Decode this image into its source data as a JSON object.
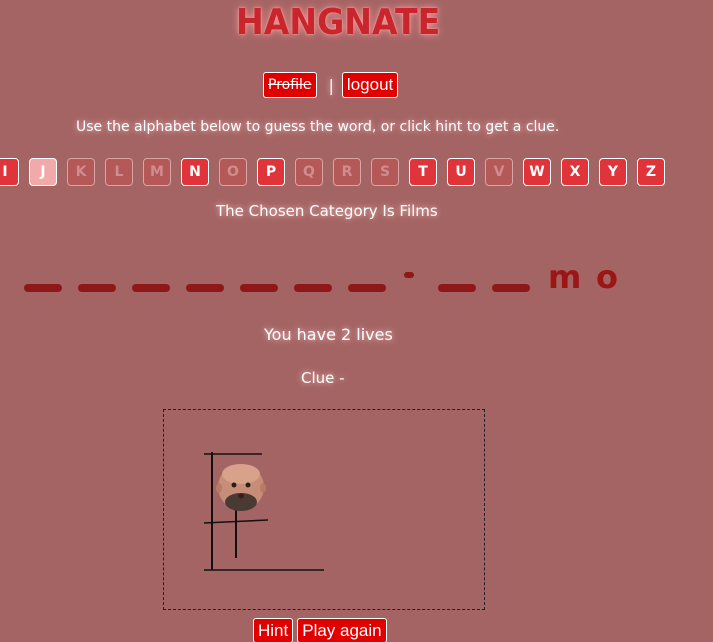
{
  "app": {
    "title": "HANGNATE"
  },
  "nav": {
    "profile_label": "Profile",
    "separator": "|",
    "logout_label": "logout"
  },
  "instructions": "Use the alphabet below to guess the word, or click hint to get a clue.",
  "alphabet": [
    {
      "letter": "I",
      "state": "available"
    },
    {
      "letter": "J",
      "state": "selected"
    },
    {
      "letter": "K",
      "state": "used"
    },
    {
      "letter": "L",
      "state": "used"
    },
    {
      "letter": "M",
      "state": "used"
    },
    {
      "letter": "N",
      "state": "available"
    },
    {
      "letter": "O",
      "state": "used"
    },
    {
      "letter": "P",
      "state": "available"
    },
    {
      "letter": "Q",
      "state": "used"
    },
    {
      "letter": "R",
      "state": "used"
    },
    {
      "letter": "S",
      "state": "used"
    },
    {
      "letter": "T",
      "state": "available"
    },
    {
      "letter": "U",
      "state": "available"
    },
    {
      "letter": "V",
      "state": "used"
    },
    {
      "letter": "W",
      "state": "available"
    },
    {
      "letter": "X",
      "state": "available"
    },
    {
      "letter": "Y",
      "state": "available"
    },
    {
      "letter": "Z",
      "state": "available"
    }
  ],
  "category": "The Chosen Category Is Films",
  "word": [
    "",
    "",
    "",
    "",
    "",
    "",
    "",
    "-",
    "",
    "",
    "m",
    "o"
  ],
  "lives_text": "You have 2 lives",
  "clue_text": "Clue -",
  "buttons": {
    "hint_label": "Hint",
    "play_again_label": "Play again"
  },
  "colors": {
    "background": "#a56464",
    "button": "#e00000",
    "accent": "#c8262c",
    "word": "#8f1717"
  }
}
